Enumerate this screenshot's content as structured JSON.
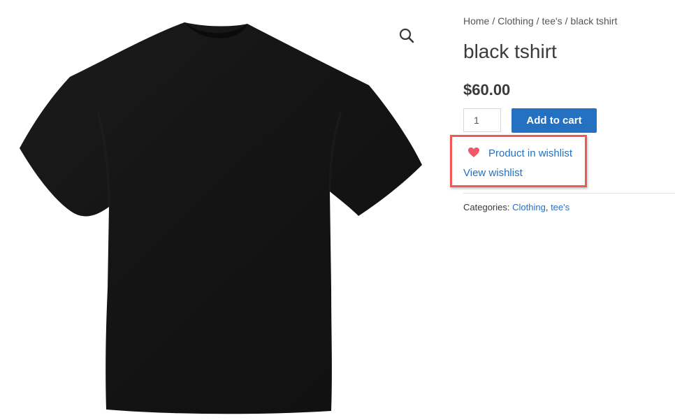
{
  "breadcrumb": {
    "items": [
      "Home",
      "Clothing",
      "tee's"
    ],
    "separator": "/",
    "current": "black tshirt"
  },
  "product": {
    "title": "black tshirt",
    "price": "$60.00",
    "image_alt": "black t-shirt",
    "color": "#141414"
  },
  "cart": {
    "quantity": "1",
    "add_label": "Add to cart",
    "button_color": "#2470c1"
  },
  "wishlist": {
    "status": "Product in wishlist",
    "view_label": "View wishlist",
    "heart_color": "#ee5a6a",
    "highlight_color": "#ee5a52"
  },
  "meta": {
    "categories_label": "Categories:",
    "categories": [
      "Clothing",
      "tee's"
    ],
    "separator": ","
  },
  "icons": {
    "zoom": "magnifier-icon",
    "heart": "heart-icon"
  }
}
